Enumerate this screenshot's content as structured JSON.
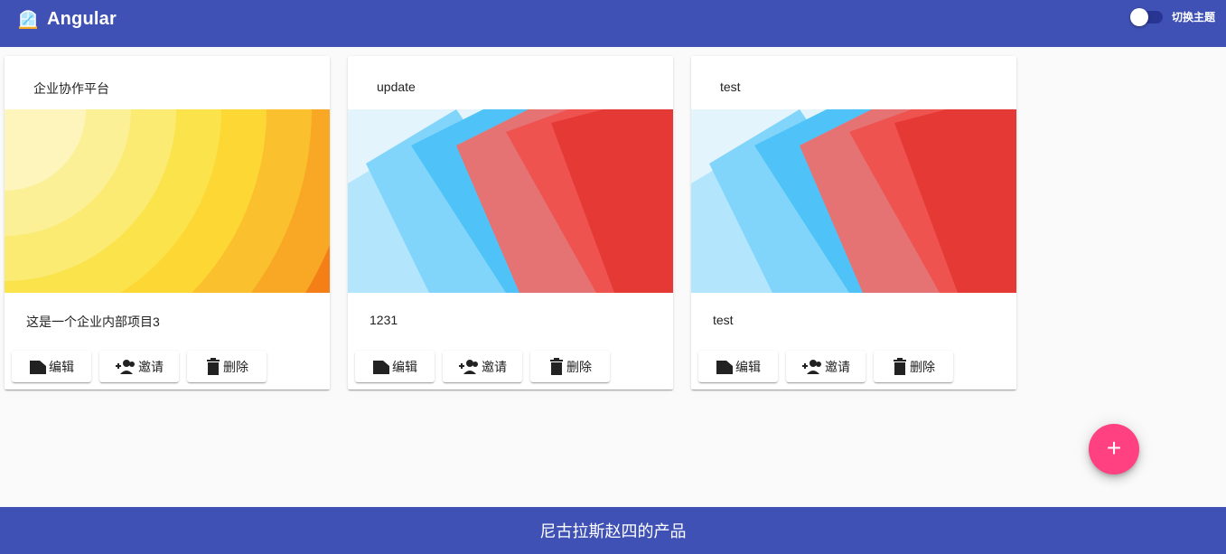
{
  "header": {
    "app_title": "Angular",
    "logo_icon": "angular-building-icon",
    "theme_toggle_label": "切换主题",
    "theme_toggle_on": false
  },
  "projects": [
    {
      "title": "企业协作平台",
      "description": "这是一个企业内部项目3",
      "cover": "sun-rings-cover",
      "actions": {
        "edit": "编辑",
        "invite": "邀请",
        "delete": "删除"
      }
    },
    {
      "title": "update",
      "description": "1231",
      "cover": "paper-fan-cover",
      "actions": {
        "edit": "编辑",
        "invite": "邀请",
        "delete": "删除"
      }
    },
    {
      "title": "test",
      "description": "test",
      "cover": "paper-fan-cover",
      "actions": {
        "edit": "编辑",
        "invite": "邀请",
        "delete": "删除"
      }
    }
  ],
  "fab": {
    "label": "+",
    "icon": "add-icon"
  },
  "footer": {
    "text": "尼古拉斯赵四的产品"
  },
  "colors": {
    "primary": "#3f51b5",
    "accent": "#ff4081",
    "background": "#fafafa"
  }
}
